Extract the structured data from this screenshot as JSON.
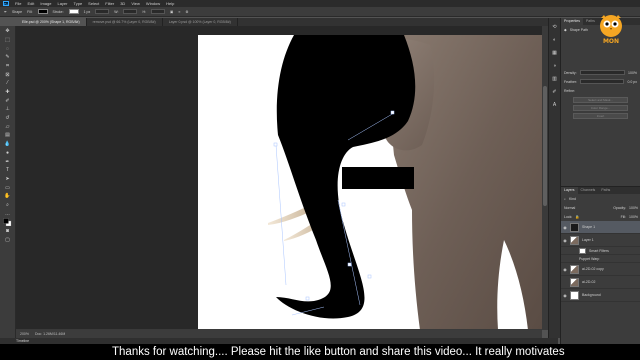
{
  "menu": {
    "logo": "Ps",
    "items": [
      "File",
      "Edit",
      "Image",
      "Layer",
      "Type",
      "Select",
      "Filter",
      "3D",
      "View",
      "Window",
      "Help"
    ]
  },
  "options": {
    "mode": "Shape",
    "fill_label": "Fill:",
    "stroke_label": "Stroke:",
    "stroke_size": "1 px",
    "w_label": "W:",
    "h_label": "H:"
  },
  "tabs": [
    "Elle.psd @ 200% (Shape 1, RGB/8#)",
    "remove.psd @ 66.7% (Layer 0, RGB/8#)",
    "Layer 0.psd @ 100% (Layer 0, RGB/8#)"
  ],
  "status": {
    "zoom": "200%",
    "doc": "Doc: 1.26M/11.46M"
  },
  "timeline": {
    "label": "Timeline"
  },
  "properties": {
    "tabs": [
      "Properties",
      "Paths"
    ],
    "kind": "Shape Path",
    "density_label": "Density:",
    "density_value": "100%",
    "feather_label": "Feather:",
    "feather_value": "0.0 px",
    "refine_label": "Refine:",
    "buttons": [
      "Select and Mask...",
      "Color Range...",
      "Invert"
    ]
  },
  "layers_panel": {
    "tabs": [
      "Layers",
      "Channels",
      "Paths"
    ],
    "filter_label": "Kind",
    "blend_mode": "Normal",
    "opacity_label": "Opacity:",
    "opacity_value": "100%",
    "lock_label": "Lock:",
    "fill_label": "Fill:",
    "fill_value": "100%",
    "layers": [
      {
        "name": "Shape 1",
        "type": "shape",
        "active": true
      },
      {
        "name": "Layer 1",
        "type": "ele",
        "active": false
      },
      {
        "name": "Smart Filters",
        "type": "sub",
        "active": false
      },
      {
        "name": "Puppet Warp",
        "type": "sub",
        "active": false
      },
      {
        "name": "ai-2D-02 copy",
        "type": "ele",
        "active": false
      },
      {
        "name": "ai-2D-02",
        "type": "ele",
        "active": false
      },
      {
        "name": "Background",
        "type": "bg",
        "active": false
      }
    ]
  },
  "caption": "Thanks for watching.... Please hit the like button and share this video... It really motivates",
  "watermark": {
    "text": "MON"
  }
}
